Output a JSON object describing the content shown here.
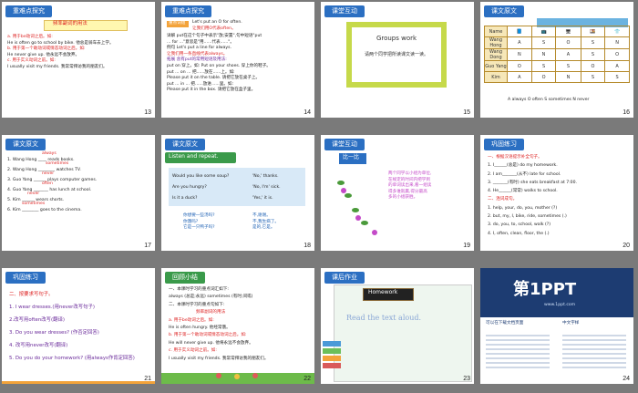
{
  "slides": [
    {
      "num": "13",
      "title": "重难点探究",
      "subtitle": "频率副词的用法",
      "lines": [
        "a. 用于be动词之后。如:",
        "He is often go to school by bike. 他总是骑车去上学。",
        "b. 用于第一个助动词或情态动词之后。如:",
        "He never give up. 他永远不会放弃。",
        "c. 用于实义动词之前。如:",
        "I usually visit my friends. 我常常拜访我的朋友们。"
      ]
    },
    {
      "num": "14",
      "title": "重难点探究",
      "badge": "重点词组",
      "lines": [
        "Let's put an O for often.",
        "让我们用O代表often。",
        "详解 put在这个句子中表示\"放;安置\",句中短语\"put",
        "... for ...\"意思是\"用......代表......\"。",
        "例句 Let's put a line for always.",
        "让我们用一条直线代表always。",
        "拓展 含有put的常用短语及用法:",
        "put on 穿上。如: Put on your shoes. 穿上你的鞋子。",
        "put ... on ... 把......放在......上。如:",
        "Please put it on the table. 请把它放在桌子上。",
        "put ... in ... 把......放进......里。如:",
        "Please put it in the box. 请把它放在盒子里。"
      ]
    },
    {
      "num": "15",
      "title": "课堂互动",
      "frame_title": "Groups work",
      "frame_text": "请两个同学把所读课文读一读。"
    },
    {
      "num": "16",
      "title": "课文原文",
      "headers": [
        "",
        "Name",
        "",
        "",
        "",
        "",
        ""
      ],
      "rows": [
        [
          "Wang Hong",
          "A",
          "S",
          "O",
          "S",
          "N"
        ],
        [
          "Wang Dong",
          "N",
          "N",
          "A",
          "S",
          "O"
        ],
        [
          "Guo Yang",
          "O",
          "S",
          "S",
          "O",
          "A"
        ],
        [
          "Kim",
          "A",
          "O",
          "N",
          "S",
          "S"
        ]
      ],
      "legend": "A always   O often   S sometimes   N never"
    },
    {
      "num": "17",
      "title": "课文原文",
      "lines": [
        "1. Wang Hong ____ reads books.",
        "2. Wang Hong ________ watches TV.",
        "3. Guo Yang ______ plays computer games.",
        "4. Guo Yang _______ has lunch at school.",
        "5. Kim ______ wears shorts.",
        "6. Kim ________ goes to the cinema."
      ],
      "answers": [
        "always",
        "sometimes",
        "never",
        "often",
        "never",
        "sometimes"
      ]
    },
    {
      "num": "18",
      "title": "课文原文",
      "listen": "Listen and repeat.",
      "lines": [
        "Would you like some soup?",
        "'No,' thanks.",
        "Are you hungry?",
        "'No, I'm' sick.",
        "Is it a duck?",
        "'Yes,' it is."
      ],
      "notes": [
        "你想要一些汤吗?",
        "不,谢谢。",
        "你饿吗?",
        "不,我生病了。",
        "它是一只鸭子吗?",
        "是的,它是。"
      ]
    },
    {
      "num": "19",
      "title": "课堂互动",
      "tag": "比一比",
      "text": [
        "两个同学以小组为单位,",
        "在规定的时间内把学到",
        "的单词读出来,看一组读",
        "得多谁就赢,得分最高",
        "多的小组获胜。"
      ]
    },
    {
      "num": "20",
      "title": "巩固练习",
      "lines": [
        "一、根据汉语提示补全句子。",
        "1. I______(总是) do my homework.",
        "2. I am_______(从不) late for school.",
        "3. _______(有时) she eats breakfast at 7:00.",
        "4. He______(常常) walks to school.",
        "二、连词成句。",
        "1. help, your, do, you, mother (?)",
        "2. but, my, I, bike, ride, sometimes (.)",
        "3. do, you, to, school, walk (?)",
        "4. I, often, clean, floor, the (.)"
      ]
    },
    {
      "num": "21",
      "title": "巩固练习",
      "lines": [
        "二、按要求写句子。",
        "1. I wear dresses.(用never改写句子)",
        "2.改写用often改写(翻译)",
        "3. Do you wear dresses? (作否定回答)",
        "4. 改写用never改写(翻译)",
        "5. Do you do your homework? (用always作肯定回答)"
      ]
    },
    {
      "num": "22",
      "title": "回顾小结",
      "lines": [
        "一、本课时学习的重点词汇如下:",
        "always (总是;永远) sometimes (有时;间或)",
        "二、本课时学习的重点句如下:",
        "频率副词的用法",
        "a. 用于be动词之后。如:",
        "He is often hungry. 他经常饿。",
        "b. 用于第一个助动词或情态动词之后。如:",
        "He will never give up. 他将永远不会放弃。",
        "c. 用于实义动词之前。如:",
        "I usually visit my friends. 我常常拜访我的朋友们。"
      ]
    },
    {
      "num": "23",
      "title": "课后作业",
      "hw": "Homework",
      "read": "Read the text aloud."
    },
    {
      "num": "24",
      "logo": "第1PPT",
      "url": "www.1ppt.com",
      "col1": "可以在下载文档页面",
      "col2": "中文字样"
    }
  ],
  "colors": {
    "blue": "#2b6fc2",
    "green": "#3a9a4a",
    "red": "#d22222",
    "orange": "#f3a33a"
  }
}
